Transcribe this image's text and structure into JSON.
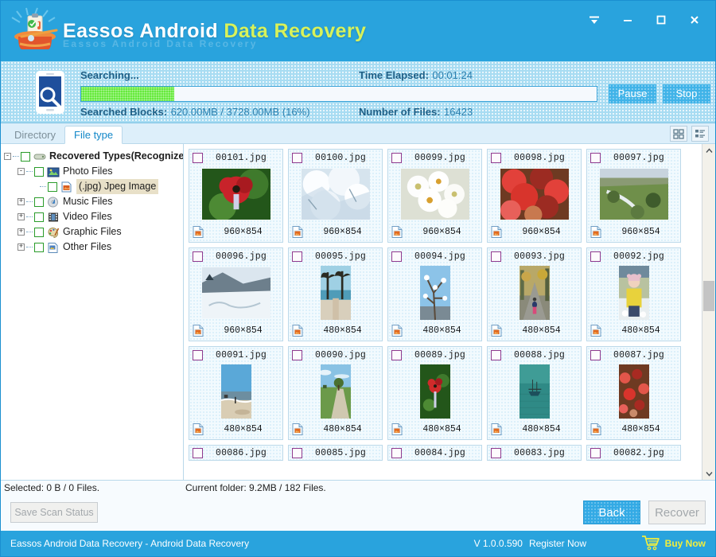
{
  "app": {
    "brand_part1": "Eassos Android",
    "brand_part2": "Data Recovery",
    "brand_ghost": "Eassos Android Data Recovery",
    "accent": "#29a3dd",
    "accent_yellow": "#d8f25a",
    "progress_green": "#66ea3c"
  },
  "window_controls": {
    "menu": "menu-icon",
    "minimize": "minimize-icon",
    "maximize": "maximize-icon",
    "close": "close-icon"
  },
  "scan": {
    "status_label": "Searching...",
    "time_label": "Time Elapsed:",
    "time_value": "00:01:24",
    "blocks_label": "Searched Blocks:",
    "blocks_value": "620.00MB / 3728.00MB (16%)",
    "files_label": "Number of Files:",
    "files_value": "16423",
    "progress_percent": 18,
    "pause_label": "Pause",
    "stop_label": "Stop",
    "device_icon": "phone-search-icon"
  },
  "tabs": [
    {
      "label": "Directory",
      "active": false
    },
    {
      "label": "File type",
      "active": true
    }
  ],
  "view_modes": [
    {
      "name": "grid-view-button",
      "active": true
    },
    {
      "name": "list-view-button",
      "active": false
    }
  ],
  "tree": [
    {
      "label": "Recovered Types(Recognized",
      "indent": 0,
      "expander": "-",
      "icon": "drive-icon",
      "bold": true,
      "selected": false
    },
    {
      "label": "Photo Files",
      "indent": 1,
      "expander": "-",
      "icon": "photo-icon",
      "bold": false,
      "selected": false
    },
    {
      "label": "(.jpg) Jpeg Image",
      "indent": 2,
      "expander": "",
      "icon": "jpeg-icon",
      "bold": false,
      "selected": true
    },
    {
      "label": "Music Files",
      "indent": 1,
      "expander": "+",
      "icon": "music-icon",
      "bold": false,
      "selected": false
    },
    {
      "label": "Video Files",
      "indent": 1,
      "expander": "+",
      "icon": "video-icon",
      "bold": false,
      "selected": false
    },
    {
      "label": "Graphic Files",
      "indent": 1,
      "expander": "+",
      "icon": "graphic-icon",
      "bold": false,
      "selected": false
    },
    {
      "label": "Other Files",
      "indent": 1,
      "expander": "+",
      "icon": "other-icon",
      "bold": false,
      "selected": false
    }
  ],
  "files": [
    {
      "name": "00101.jpg",
      "dim": "960×854",
      "w": 86,
      "h": 64,
      "c1": "#2f6b1f",
      "c2": "#c8232a",
      "c3": "#7ba33f",
      "kind": "flower",
      "clipped": false
    },
    {
      "name": "00100.jpg",
      "dim": "960×854",
      "w": 86,
      "h": 64,
      "c1": "#bcd2e0",
      "c2": "#f2f6fa",
      "c3": "#8fa9bd",
      "kind": "snow",
      "clipped": false
    },
    {
      "name": "00099.jpg",
      "dim": "960×854",
      "w": 86,
      "h": 64,
      "c1": "#e8e6e0",
      "c2": "#ffffff",
      "c3": "#c9c070",
      "kind": "blossom",
      "clipped": false
    },
    {
      "name": "00098.jpg",
      "dim": "960×854",
      "w": 86,
      "h": 64,
      "c1": "#9c2b22",
      "c2": "#e2413a",
      "c3": "#c8794f",
      "kind": "redleaf",
      "clipped": false
    },
    {
      "name": "00097.jpg",
      "dim": "960×854",
      "w": 86,
      "h": 64,
      "c1": "#6f8f4a",
      "c2": "#aebf86",
      "c3": "#4d6b3a",
      "kind": "landscape",
      "clipped": false
    },
    {
      "name": "00096.jpg",
      "dim": "960×854",
      "w": 86,
      "h": 64,
      "c1": "#5e6e7c",
      "c2": "#dce6ee",
      "c3": "#3a4a56",
      "kind": "snowlake",
      "clipped": false
    },
    {
      "name": "00095.jpg",
      "dim": "480×854",
      "w": 38,
      "h": 68,
      "c1": "#7fb8d8",
      "c2": "#2b2b22",
      "c3": "#d8cfbc",
      "kind": "palm",
      "clipped": false
    },
    {
      "name": "00094.jpg",
      "dim": "480×854",
      "w": 38,
      "h": 68,
      "c1": "#8cc3e8",
      "c2": "#ffffff",
      "c3": "#5a4a3a",
      "kind": "branch",
      "clipped": false
    },
    {
      "name": "00093.jpg",
      "dim": "480×854",
      "w": 38,
      "h": 68,
      "c1": "#c8a martin",
      "c2": "#8a8a82",
      "c3": "#c9a64a",
      "kind": "road",
      "clipped": false
    },
    {
      "name": "00092.jpg",
      "dim": "480×854",
      "w": 38,
      "h": 68,
      "c1": "#e8c0cc",
      "c2": "#e8d23c",
      "c3": "#b8c2a0",
      "kind": "child",
      "clipped": false
    },
    {
      "name": "00091.jpg",
      "dim": "480×854",
      "w": 38,
      "h": 68,
      "c1": "#5aa8d8",
      "c2": "#d9cdb4",
      "c3": "#6d8ea0",
      "kind": "beach",
      "clipped": false
    },
    {
      "name": "00090.jpg",
      "dim": "480×854",
      "w": 38,
      "h": 68,
      "c1": "#89c2e4",
      "c2": "#6b9a4a",
      "c3": "#4a7030",
      "kind": "park",
      "clipped": false
    },
    {
      "name": "00089.jpg",
      "dim": "480×854",
      "w": 38,
      "h": 68,
      "c1": "#3f6b25",
      "c2": "#d02b2b",
      "c3": "#79a340",
      "kind": "flower",
      "clipped": false
    },
    {
      "name": "00088.jpg",
      "dim": "480×854",
      "w": 38,
      "h": 68,
      "c1": "#2f8a86",
      "c2": "#1d4f5c",
      "c3": "#3f9c96",
      "kind": "boat",
      "clipped": false
    },
    {
      "name": "00087.jpg",
      "dim": "480×854",
      "w": 38,
      "h": 68,
      "c1": "#a82a22",
      "c2": "#e2564a",
      "c3": "#c98a6a",
      "kind": "redleaf",
      "clipped": false
    },
    {
      "name": "00086.jpg",
      "dim": "",
      "w": 0,
      "h": 0,
      "c1": "",
      "c2": "",
      "c3": "",
      "kind": "",
      "clipped": true
    },
    {
      "name": "00085.jpg",
      "dim": "",
      "w": 0,
      "h": 0,
      "c1": "",
      "c2": "",
      "c3": "",
      "kind": "",
      "clipped": true
    },
    {
      "name": "00084.jpg",
      "dim": "",
      "w": 0,
      "h": 0,
      "c1": "",
      "c2": "",
      "c3": "",
      "kind": "",
      "clipped": true
    },
    {
      "name": "00083.jpg",
      "dim": "",
      "w": 0,
      "h": 0,
      "c1": "",
      "c2": "",
      "c3": "",
      "kind": "",
      "clipped": true
    },
    {
      "name": "00082.jpg",
      "dim": "",
      "w": 0,
      "h": 0,
      "c1": "",
      "c2": "",
      "c3": "",
      "kind": "",
      "clipped": true
    }
  ],
  "status": {
    "selected": "Selected: 0 B / 0 Files.",
    "current_folder": "Current folder: 9.2MB / 182 Files."
  },
  "actions": {
    "save_scan_status": "Save Scan Status",
    "back": "Back",
    "recover": "Recover"
  },
  "footer": {
    "title": "Eassos Android Data Recovery - Android Data Recovery",
    "version": "V 1.0.0.590",
    "register": "Register Now",
    "buy": "Buy Now",
    "cart_icon": "shopping-cart-icon"
  }
}
